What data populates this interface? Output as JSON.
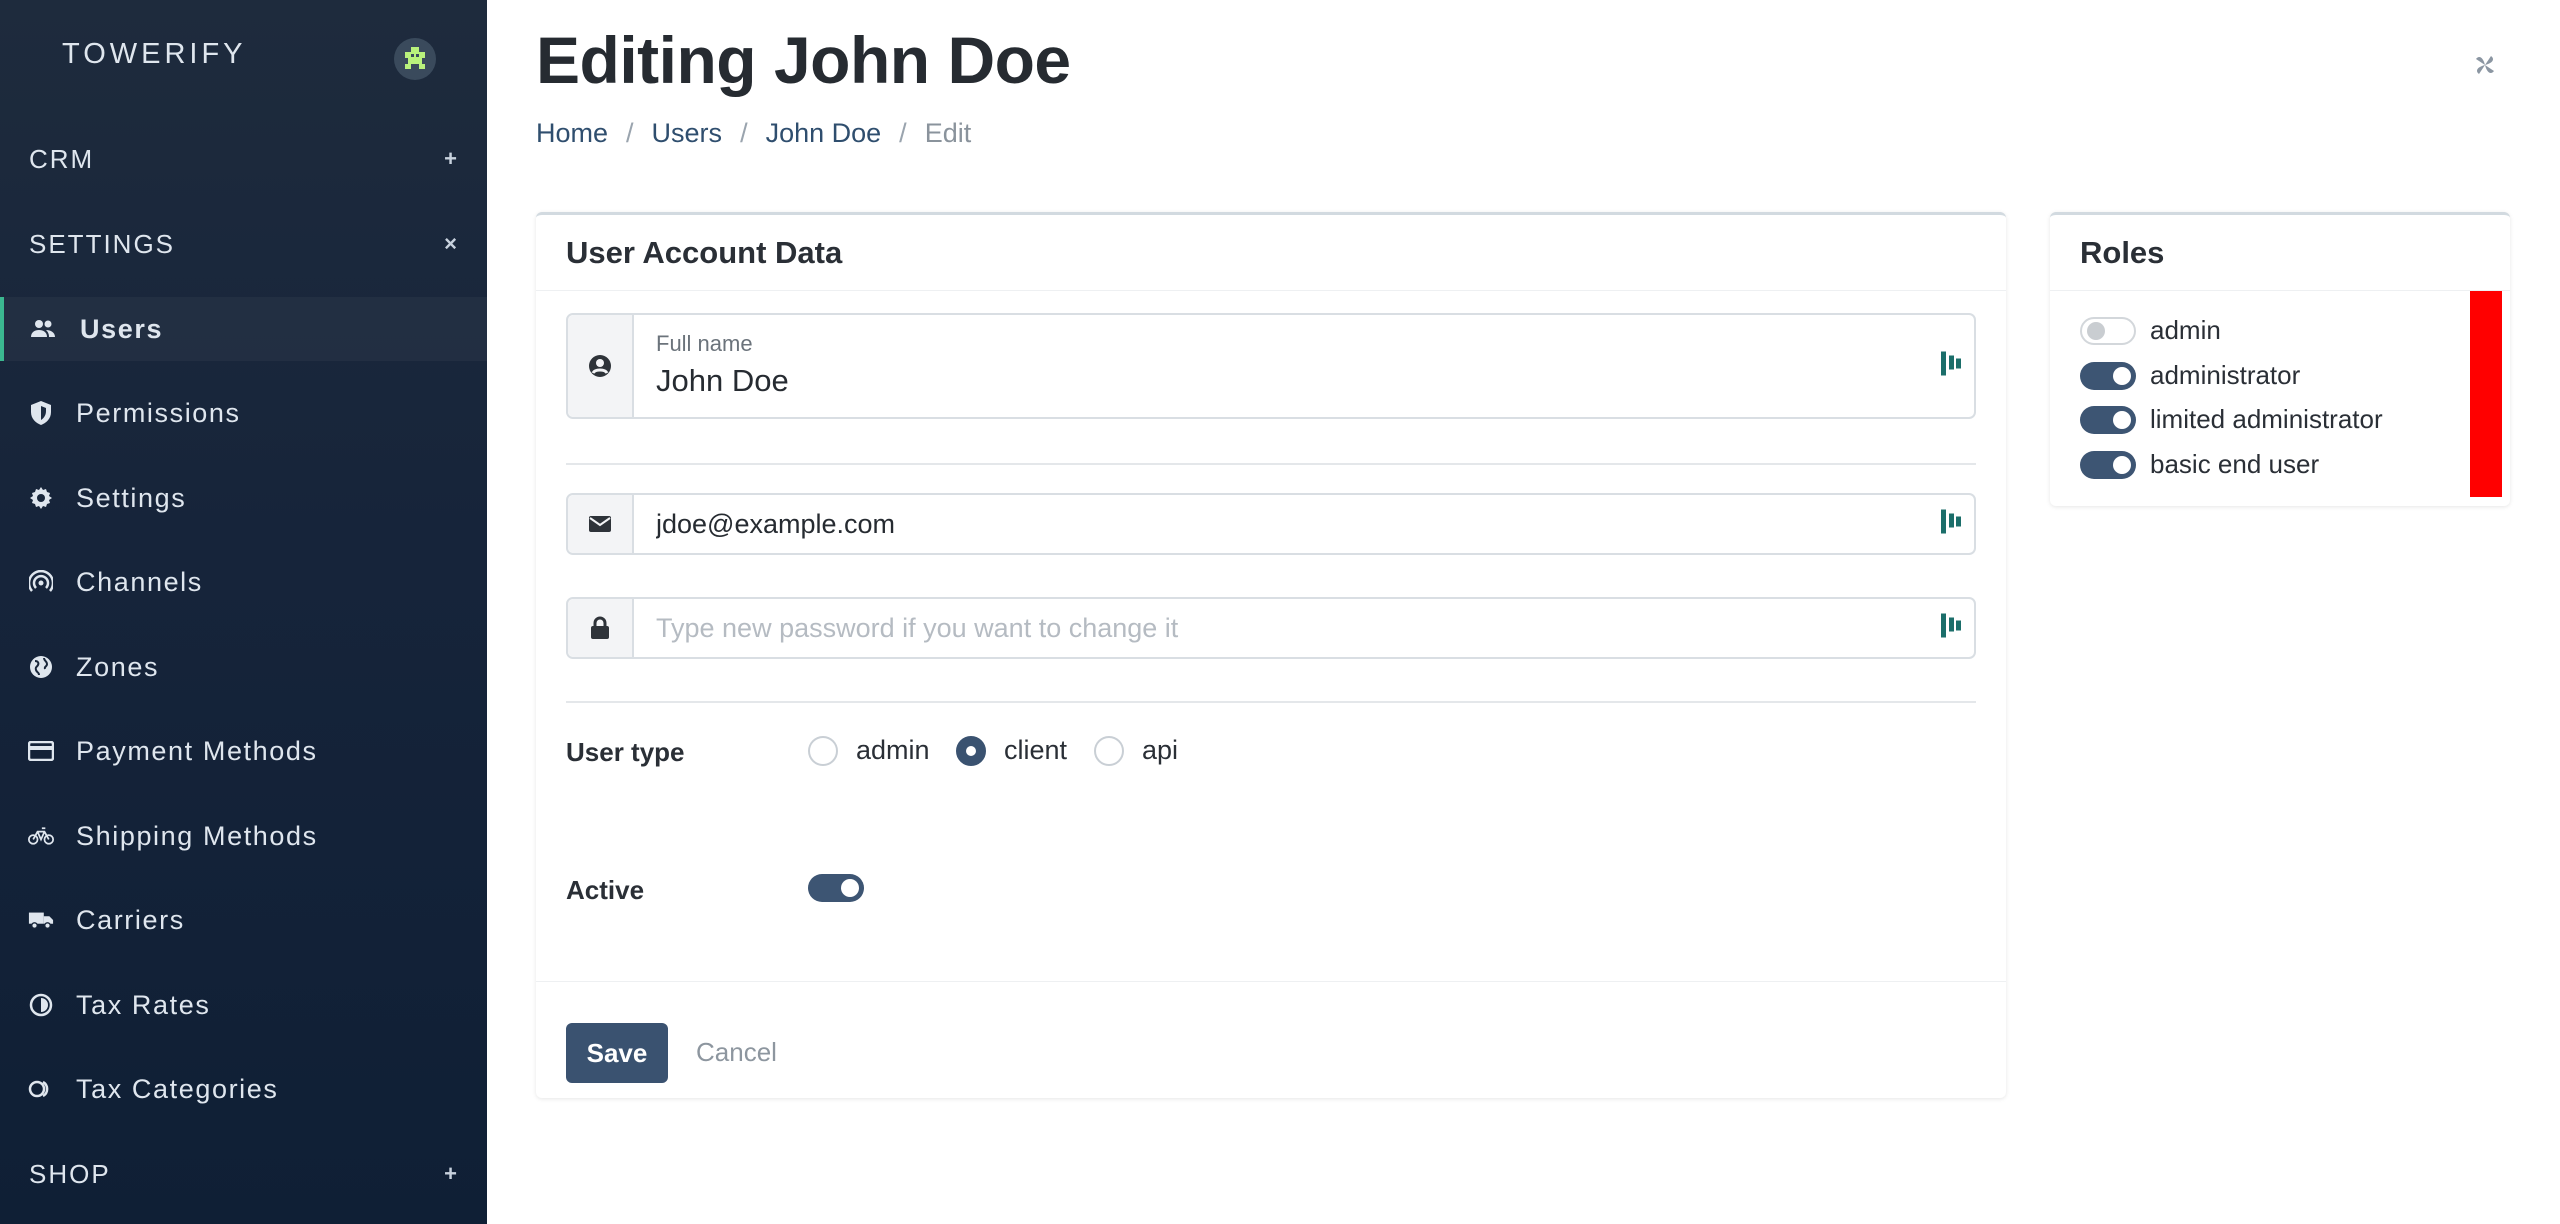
{
  "sidebar": {
    "brand": "TOWERIFY",
    "sections": {
      "crm": {
        "label": "CRM",
        "toggle": "+"
      },
      "settings": {
        "label": "SETTINGS",
        "toggle": "×"
      },
      "shop": {
        "label": "SHOP",
        "toggle": "+"
      }
    },
    "items": [
      {
        "label": "Users",
        "icon": "users-icon",
        "active": true
      },
      {
        "label": "Permissions",
        "icon": "shield-icon"
      },
      {
        "label": "Settings",
        "icon": "gear-icon"
      },
      {
        "label": "Channels",
        "icon": "broadcast-icon"
      },
      {
        "label": "Zones",
        "icon": "globe-icon"
      },
      {
        "label": "Payment Methods",
        "icon": "credit-card-icon"
      },
      {
        "label": "Shipping Methods",
        "icon": "bicycle-icon"
      },
      {
        "label": "Carriers",
        "icon": "truck-icon"
      },
      {
        "label": "Tax Rates",
        "icon": "pie-icon"
      },
      {
        "label": "Tax Categories",
        "icon": "tags-icon"
      }
    ]
  },
  "header": {
    "title": "Editing John Doe",
    "breadcrumb": {
      "home": "Home",
      "users": "Users",
      "user": "John Doe",
      "current": "Edit",
      "separator": "/"
    }
  },
  "account_card": {
    "title": "User Account Data",
    "full_name": {
      "label": "Full name",
      "value": "John Doe"
    },
    "email": {
      "value": "jdoe@example.com"
    },
    "password": {
      "placeholder": "Type new password if you want to change it"
    },
    "user_type": {
      "label": "User type",
      "options": [
        "admin",
        "client",
        "api"
      ],
      "selected": "client"
    },
    "active": {
      "label": "Active",
      "value": true
    },
    "save_label": "Save",
    "cancel_label": "Cancel"
  },
  "roles_card": {
    "title": "Roles",
    "roles": [
      {
        "name": "admin",
        "enabled": false
      },
      {
        "name": "administrator",
        "enabled": true
      },
      {
        "name": "limited administrator",
        "enabled": true
      },
      {
        "name": "basic end user",
        "enabled": true
      }
    ]
  },
  "colors": {
    "sidebar_bg": "#16243a",
    "accent": "#3a5270",
    "active_indicator": "#3bb890",
    "roles_marker": "#ff0000"
  }
}
